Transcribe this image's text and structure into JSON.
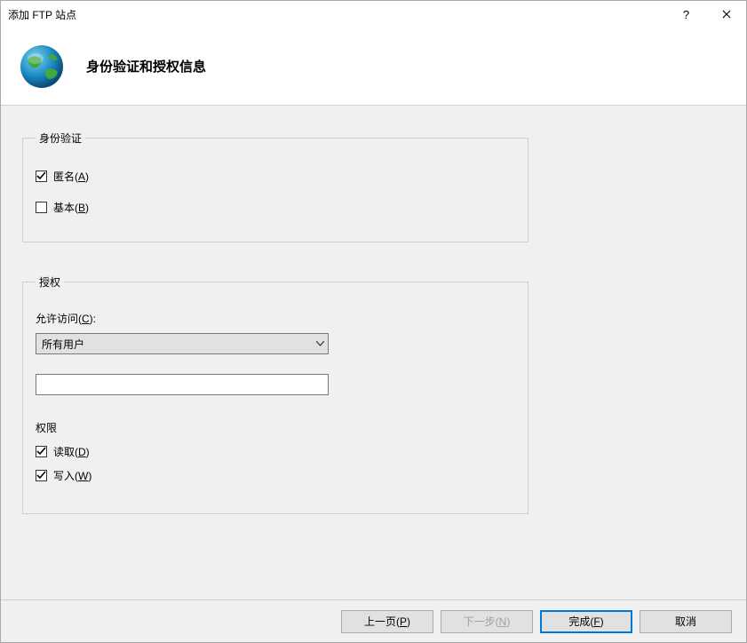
{
  "window": {
    "title": "添加 FTP 站点"
  },
  "header": {
    "title": "身份验证和授权信息"
  },
  "auth": {
    "legend": "身份验证",
    "anonymous": {
      "label_pre": "匿名(",
      "key": "A",
      "label_post": ")",
      "checked": true
    },
    "basic": {
      "label_pre": "基本(",
      "key": "B",
      "label_post": ")",
      "checked": false
    }
  },
  "authorization": {
    "legend": "授权",
    "allow_access_label_pre": "允许访问(",
    "allow_access_key": "C",
    "allow_access_label_post": "):",
    "combo_selected": "所有用户",
    "textbox_value": "",
    "permissions_heading": "权限",
    "read": {
      "label_pre": "读取(",
      "key": "D",
      "label_post": ")",
      "checked": true
    },
    "write": {
      "label_pre": "写入(",
      "key": "W",
      "label_post": ")",
      "checked": true
    }
  },
  "buttons": {
    "prev_pre": "上一页(",
    "prev_key": "P",
    "prev_post": ")",
    "next_pre": "下一步(",
    "next_key": "N",
    "next_post": ")",
    "finish_pre": "完成(",
    "finish_key": "F",
    "finish_post": ")",
    "cancel": "取消"
  }
}
